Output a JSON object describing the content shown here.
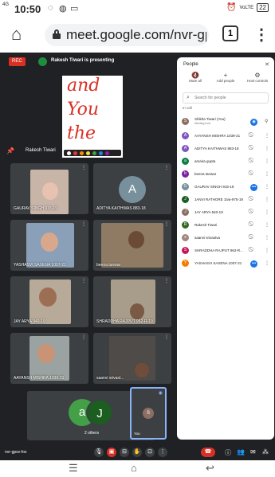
{
  "status_bar": {
    "time": "10:50",
    "signal": "4G",
    "right_icons": "VoLTE",
    "battery": "22"
  },
  "browser": {
    "url": "meet.google.com/nvr-gp",
    "tab_count": "1"
  },
  "meeting": {
    "rec_label": "REC",
    "presenting_text": "Rakesh Tiwari is presenting",
    "presenter_label": "Rakesh Tiwari",
    "whiteboard_text": [
      "and",
      "You",
      "the"
    ],
    "meeting_code": "nvr-gpsv-fox",
    "others_label": "2 others",
    "self_label": "You",
    "tiles": [
      {
        "name": "GAURAV SINGH 915-19"
      },
      {
        "name": "ADITYA KAITHWAS 883-18",
        "initial": "A"
      },
      {
        "name": "YASHASVI SAXENA 1007-21"
      },
      {
        "name": "beena tanwar"
      },
      {
        "name": "JAY ARYA 940-19"
      },
      {
        "name": "SHRADDHA RAJPUT 962-R-19"
      },
      {
        "name": "AAYANSH MISHRA 1039-21"
      },
      {
        "name": "saanvi srivast..."
      }
    ],
    "other_avatars": [
      "a",
      "J"
    ],
    "self_initial": "S"
  },
  "people_panel": {
    "title": "People",
    "actions": [
      "Mute all",
      "Add people",
      "Host controls"
    ],
    "search_placeholder": "Search for people",
    "section_label": "In call",
    "participants": [
      {
        "name": "Shikha Tiwari (You)",
        "sub": "Meeting host",
        "initial": "S",
        "color": "#8d6e63"
      },
      {
        "name": "AAYANSH MISHRA 1039-21",
        "initial": "A",
        "color": "#7e57c2"
      },
      {
        "name": "ADITYA KAITHWAS 883-18",
        "initial": "A",
        "color": "#7e57c2"
      },
      {
        "name": "amaira gupta",
        "initial": "a",
        "color": "#0b8043"
      },
      {
        "name": "beena tanwar",
        "initial": "b",
        "color": "#7b1fa2"
      },
      {
        "name": "GAURAV SINGH 915-19",
        "initial": "G",
        "color": "#78909c"
      },
      {
        "name": "JANVI RATHORE 1tva-975-19",
        "initial": "J",
        "color": "#1b5e20"
      },
      {
        "name": "JAY ARYA 940-19",
        "initial": "J",
        "color": "#8d6e63"
      },
      {
        "name": "Rakesh Tiwari",
        "initial": "R",
        "color": "#33691e"
      },
      {
        "name": "saanvi srivastva",
        "initial": "s",
        "color": "#a1887f"
      },
      {
        "name": "SHRADDHA RAJPUT 962-R...",
        "initial": "S",
        "color": "#c2185b"
      },
      {
        "name": "YASHASVI SAXENA 1007-21",
        "initial": "Y",
        "color": "#f57c00"
      }
    ]
  }
}
